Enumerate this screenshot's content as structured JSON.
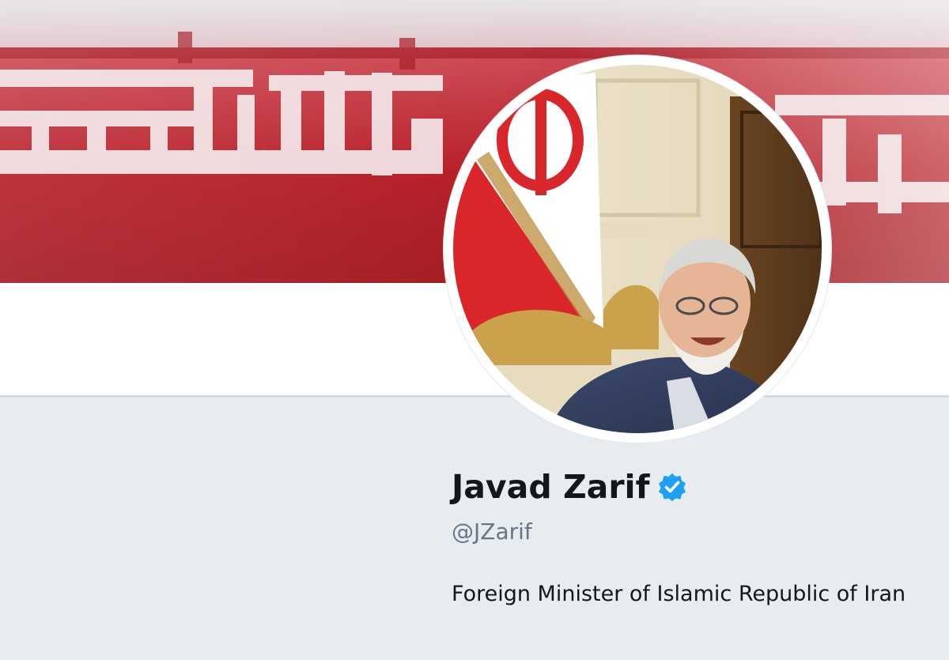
{
  "profile": {
    "display_name": "Javad Zarif",
    "handle": "@JZarif",
    "bio": "Foreign Minister of Islamic Republic of Iran",
    "verified": true
  },
  "icons": {
    "verified_badge": "verified-check-icon"
  },
  "colors": {
    "banner_red": "#b3101a",
    "verified_blue": "#1da1f2",
    "name_text": "#14171a",
    "handle_text": "#657786",
    "page_background": "#e6ecf0"
  }
}
